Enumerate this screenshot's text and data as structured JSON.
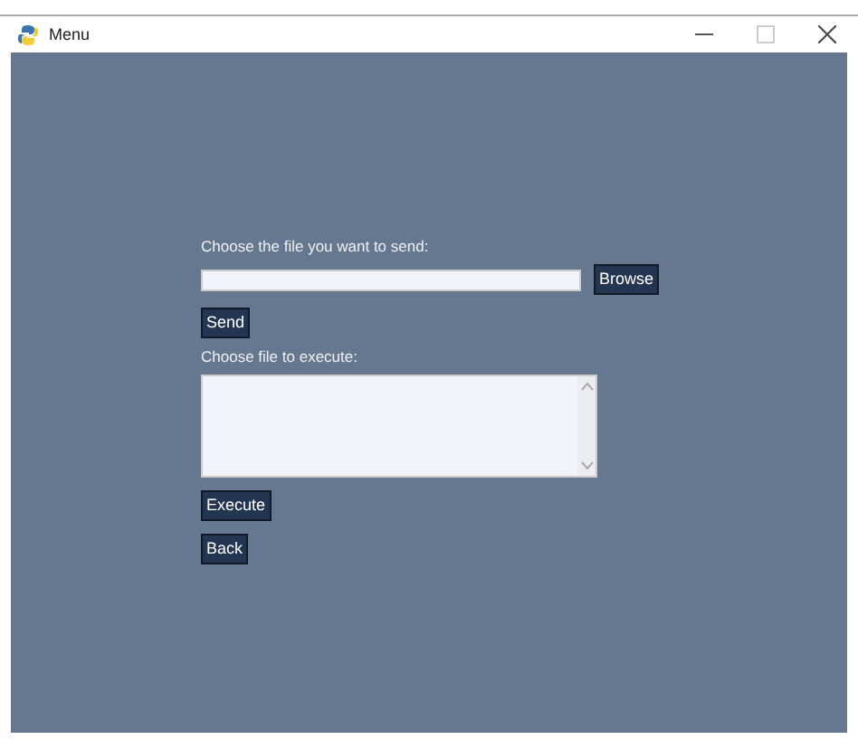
{
  "window": {
    "title": "Menu"
  },
  "send_section": {
    "label": "Choose the file you want to send:",
    "browse_button": "Browse",
    "send_button": "Send"
  },
  "execute_section": {
    "label": "Choose file to execute:",
    "execute_button": "Execute",
    "back_button": "Back"
  }
}
